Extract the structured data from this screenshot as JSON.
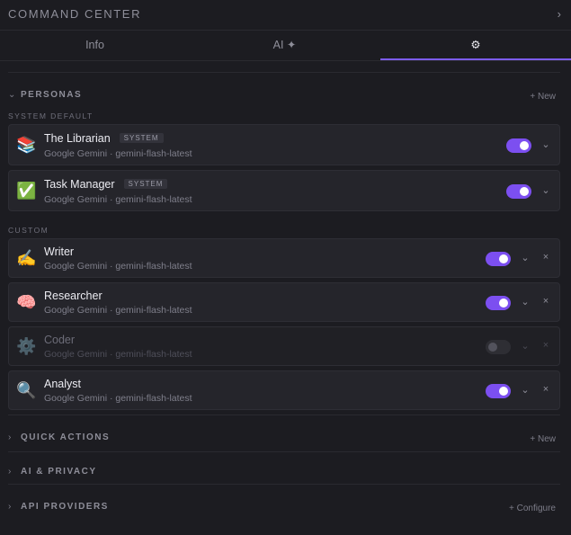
{
  "header": {
    "title": "COMMAND CENTER",
    "chevron": "›"
  },
  "tabs": [
    {
      "label": "Info"
    },
    {
      "label": "AI ✦"
    },
    {
      "label": "⚙"
    }
  ],
  "personas": {
    "title": "PERSONAS",
    "new_label": "+ New",
    "system_label": "SYSTEM DEFAULT",
    "custom_label": "CUSTOM",
    "system_items": [
      {
        "emoji": "📚",
        "name": "The Librarian",
        "badge": "SYSTEM",
        "model": "Google Gemini · gemini-flash-latest",
        "enabled": true
      },
      {
        "emoji": "✅",
        "name": "Task Manager",
        "badge": "SYSTEM",
        "model": "Google Gemini · gemini-flash-latest",
        "enabled": true
      }
    ],
    "custom_items": [
      {
        "emoji": "✍️",
        "name": "Writer",
        "model": "Google Gemini · gemini-flash-latest",
        "enabled": true
      },
      {
        "emoji": "🧠",
        "name": "Researcher",
        "model": "Google Gemini · gemini-flash-latest",
        "enabled": true
      },
      {
        "emoji": "⚙️",
        "name": "Coder",
        "model": "Google Gemini · gemini-flash-latest",
        "enabled": false
      },
      {
        "emoji": "🔍",
        "name": "Analyst",
        "model": "Google Gemini · gemini-flash-latest",
        "enabled": true
      }
    ]
  },
  "quick_actions": {
    "title": "QUICK ACTIONS",
    "new_label": "+ New"
  },
  "ai_privacy": {
    "title": "AI & PRIVACY"
  },
  "api_providers": {
    "title": "API PROVIDERS",
    "configure_label": "+ Configure"
  },
  "icons": {
    "expand": "⌄",
    "collapsed": "›",
    "remove": "×"
  }
}
